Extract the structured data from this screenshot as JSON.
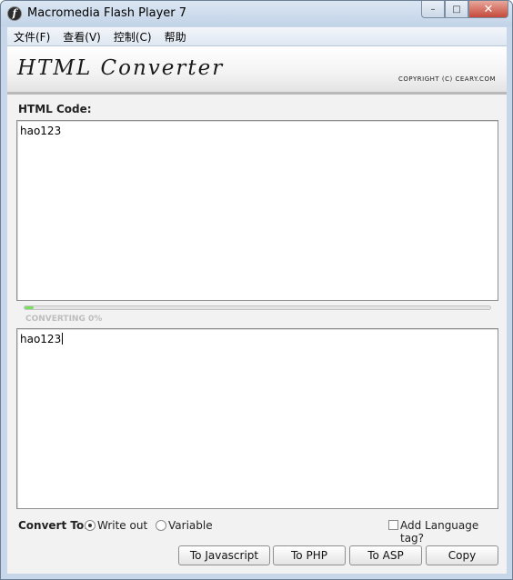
{
  "window": {
    "title": "Macromedia Flash Player 7",
    "buttons": {
      "minimize": "–",
      "maximize": "□",
      "close": "✕"
    }
  },
  "menu": [
    {
      "label": "文件(F)"
    },
    {
      "label": "查看(V)"
    },
    {
      "label": "控制(C)"
    },
    {
      "label": "帮助"
    }
  ],
  "banner": {
    "title": "HTML Converter",
    "copyright": "COPYRIGHT (C) CEARY.COM"
  },
  "input": {
    "label": "HTML Code:",
    "value": "hao123"
  },
  "progress": {
    "label": "CONVERTING 0%",
    "fraction": 0.02
  },
  "output": {
    "value": "hao123"
  },
  "options": {
    "convert_label": "Convert To:",
    "write_out_label": "Write out",
    "variable_label": "Variable",
    "selected": "write_out",
    "language_tag_label": "Add Language tag?",
    "language_tag_checked": false
  },
  "actions": {
    "javascript": "To Javascript",
    "php": "To PHP",
    "asp": "To ASP",
    "copy": "Copy"
  },
  "colors": {
    "accent_progress": "#7ddc62",
    "window_frame": "#c7d7e9"
  }
}
